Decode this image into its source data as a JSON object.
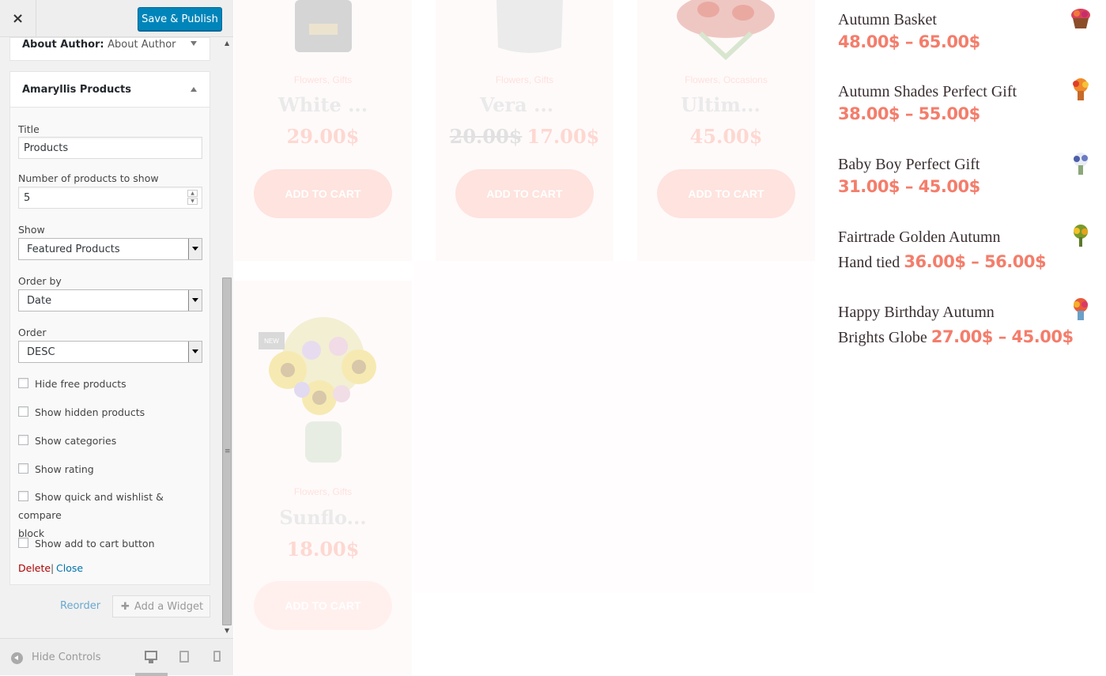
{
  "topbar": {
    "close_label": "×",
    "publish_label": "Save & Publish"
  },
  "about_widget": {
    "title": "About Author:",
    "subtitle": "About Author"
  },
  "products_widget": {
    "title": "Amaryllis Products",
    "title_label": "Title",
    "title_value": "Products",
    "num_label": "Number of products to show",
    "num_value": "5",
    "show_label": "Show",
    "show_value": "Featured Products",
    "orderby_label": "Order by",
    "orderby_value": "Date",
    "order_label": "Order",
    "order_value": "DESC",
    "checkboxes": [
      "Hide free products",
      "Show hidden products",
      "Show categories",
      "Show rating",
      "Show quick and wishlist & compare",
      "block",
      "Show add to cart button"
    ],
    "delete_label": "Delete",
    "separator": "|",
    "close_label": "Close"
  },
  "actions": {
    "reorder_label": "Reorder",
    "add_widget_label": "Add a Widget"
  },
  "footer": {
    "hide_label": "Hide Controls"
  },
  "preview": {
    "products": [
      {
        "category": "Flowers, Gifts",
        "name": "White ...",
        "price": "29.00$",
        "cart": "ADD TO CART"
      },
      {
        "category": "Flowers, Gifts",
        "name": "Vera ...",
        "old_price": "20.00$",
        "price": "17.00$",
        "cart": "ADD TO CART"
      },
      {
        "category": "Flowers, Occasions",
        "name": "Ultim...",
        "price": "45.00$",
        "cart": "ADD TO CART"
      },
      {
        "category": "Flowers, Gifts",
        "name": "Sunflo...",
        "price": "18.00$",
        "cart": "ADD TO CART",
        "badge": "NEW"
      }
    ],
    "widget_list": [
      {
        "name": "Autumn Basket",
        "price": "48.00$ – 65.00$"
      },
      {
        "name": "Autumn Shades Perfect Gift",
        "price": "38.00$ – 55.00$"
      },
      {
        "name": "Baby Boy Perfect Gift",
        "price": "31.00$ – 45.00$"
      },
      {
        "name": "Fairtrade Golden Autumn",
        "name2": "Hand tied",
        "price": "36.00$ – 56.00$"
      },
      {
        "name": "Happy Birthday Autumn",
        "name2": "Brights Globe",
        "price": "27.00$ – 45.00$"
      }
    ]
  },
  "colors": {
    "accent": "#f47d6b",
    "publish": "#0085ba",
    "link": "#0073aa",
    "delete": "#aa0000"
  }
}
